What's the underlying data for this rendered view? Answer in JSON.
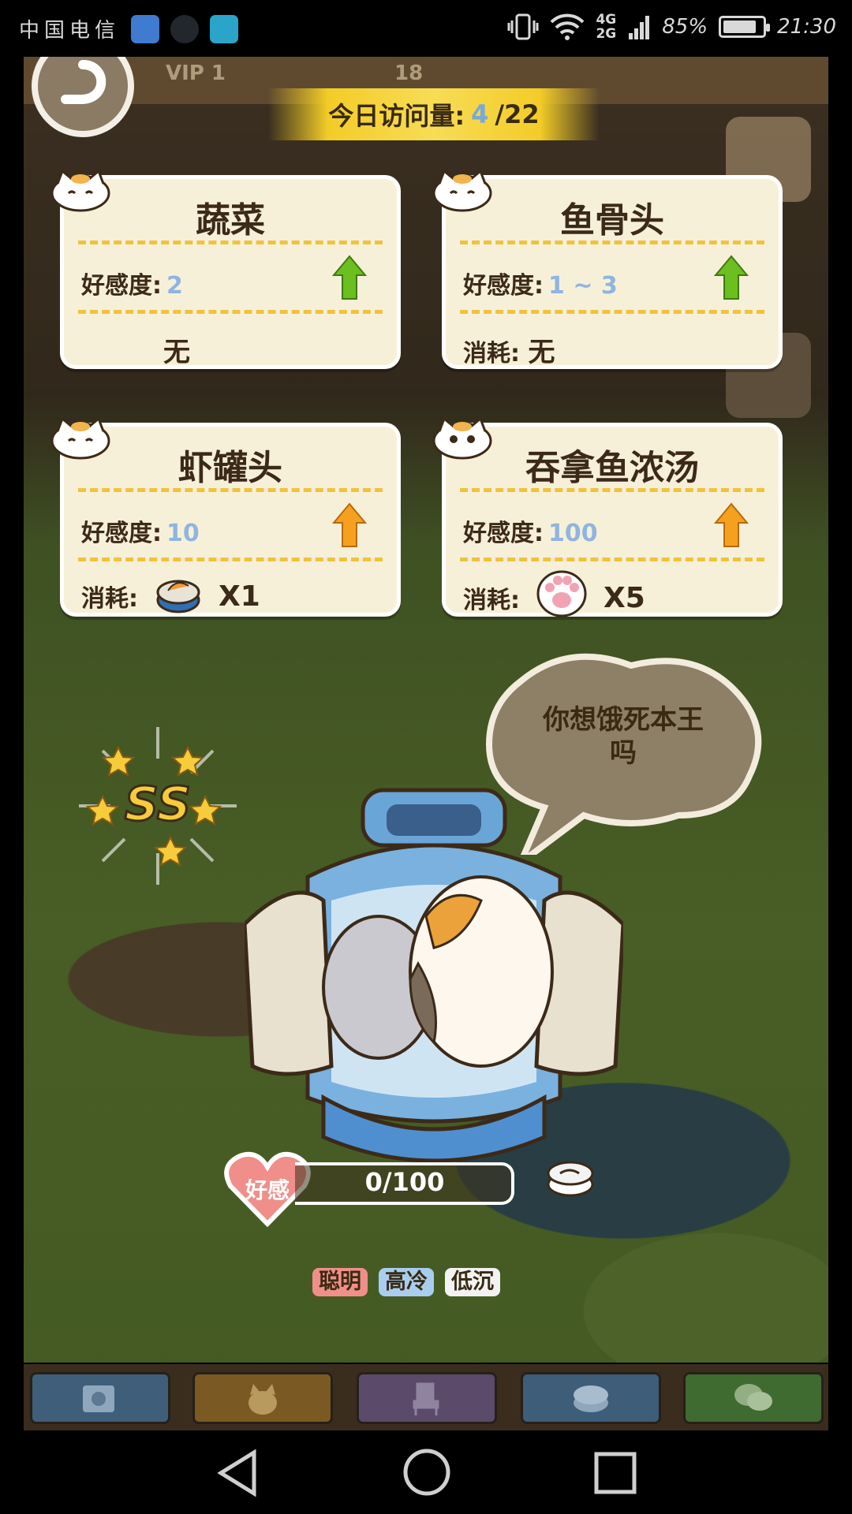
{
  "statusbar": {
    "carrier": "中国电信",
    "network_top": "4G",
    "network_bottom": "2G",
    "battery_percent": "85%",
    "battery_level": 0.85,
    "time": "21:30"
  },
  "topbar": {
    "vip": "VIP 1",
    "count": "18"
  },
  "visits": {
    "label": "今日访问量:",
    "current": "4",
    "total": "/22"
  },
  "cards": [
    {
      "title": "蔬菜",
      "affinity_label": "好感度:",
      "affinity_value": "2",
      "arrow_color": "#6bbf1f",
      "cost_text": "无",
      "cost_label": ""
    },
    {
      "title": "鱼骨头",
      "affinity_label": "好感度:",
      "affinity_value": "1 ~ 3",
      "arrow_color": "#6bbf1f",
      "cost_label": "消耗:",
      "cost_text": "无"
    },
    {
      "title": "虾罐头",
      "affinity_label": "好感度:",
      "affinity_value": "10",
      "arrow_color": "#f5a01e",
      "cost_label": "消耗:",
      "cost_icon": "shrimp-can-icon",
      "cost_count": "X1"
    },
    {
      "title": "吞拿鱼浓汤",
      "affinity_label": "好感度:",
      "affinity_value": "100",
      "arrow_color": "#f5a01e",
      "cost_label": "消耗:",
      "cost_icon": "cat-paw-icon",
      "cost_count": "X5"
    }
  ],
  "speech": {
    "line1": "你想饿死本王",
    "line2": "吗"
  },
  "rank_badge": "SS",
  "affinity": {
    "label": "好感",
    "value": "0/100"
  },
  "traits": [
    {
      "label": "聪明",
      "color": "#f08f8a"
    },
    {
      "label": "高冷",
      "color": "#a9cdef"
    },
    {
      "label": "低沉",
      "color": "#f2f2f2"
    }
  ],
  "bottom_nav": [
    {
      "icon": "cat-book-icon",
      "color": "#3f5e7a"
    },
    {
      "icon": "cat-icon",
      "color": "#7a5a22"
    },
    {
      "icon": "chair-icon",
      "color": "#5b4a6a"
    },
    {
      "icon": "food-can-icon",
      "color": "#3d5d78"
    },
    {
      "icon": "chat-bubbles-icon",
      "color": "#3f6a30"
    }
  ]
}
